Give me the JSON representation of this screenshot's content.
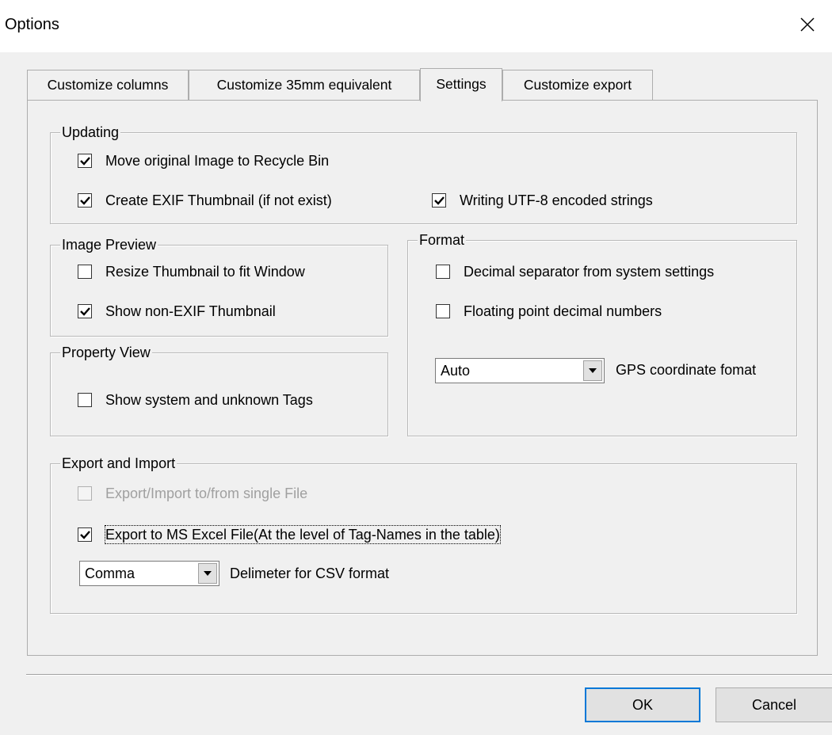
{
  "window": {
    "title": "Options",
    "close_icon": "close-icon"
  },
  "tabs": [
    {
      "label": "Customize columns",
      "active": false
    },
    {
      "label": "Customize 35mm equivalent",
      "active": false
    },
    {
      "label": "Settings",
      "active": true
    },
    {
      "label": "Customize export",
      "active": false
    }
  ],
  "updating": {
    "title": "Updating",
    "move_to_recycle": {
      "label": "Move original Image to Recycle Bin",
      "checked": true
    },
    "create_exif_thumb": {
      "label": "Create EXIF Thumbnail (if not exist)",
      "checked": true
    },
    "utf8": {
      "label": "Writing UTF-8 encoded strings",
      "checked": true
    }
  },
  "image_preview": {
    "title": "Image Preview",
    "resize_thumb": {
      "label": "Resize Thumbnail to fit Window",
      "checked": false
    },
    "show_non_exif": {
      "label": "Show non-EXIF Thumbnail",
      "checked": true
    }
  },
  "property_view": {
    "title": "Property View",
    "show_system": {
      "label": "Show system and unknown Tags",
      "checked": false
    }
  },
  "format": {
    "title": "Format",
    "decimal_sep": {
      "label": "Decimal separator from system settings",
      "checked": false
    },
    "floating_point": {
      "label": "Floating point decimal numbers",
      "checked": false
    },
    "gps_value": "Auto",
    "gps_label": "GPS coordinate fomat"
  },
  "export_import": {
    "title": "Export and Import",
    "single_file": {
      "label": "Export/Import  to/from single File",
      "checked": false,
      "disabled": true
    },
    "ms_excel": {
      "label": "Export to MS Excel File(At the level of Tag-Names in the table)",
      "checked": true
    },
    "delimiter_value": "Comma",
    "delimiter_label": "Delimeter for CSV format"
  },
  "buttons": {
    "ok": "OK",
    "cancel": "Cancel"
  }
}
